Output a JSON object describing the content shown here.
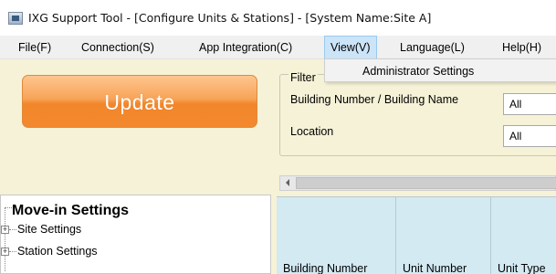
{
  "window": {
    "title": "IXG Support Tool - [Configure Units & Stations] - [System Name:Site A]"
  },
  "menu": {
    "items": [
      {
        "label": "File(F)"
      },
      {
        "label": "Connection(S)"
      },
      {
        "label": "App Integration(C)"
      },
      {
        "label": "View(V)",
        "active": true
      },
      {
        "label": "Language(L)"
      },
      {
        "label": "Help(H)"
      }
    ],
    "view_dropdown": {
      "items": [
        {
          "label": "Administrator Settings"
        }
      ]
    }
  },
  "toolbar": {
    "update_label": "Update"
  },
  "filter": {
    "legend": "Filter",
    "building_label": "Building Number / Building Name",
    "building_value": "All",
    "location_label": "Location",
    "location_value": "All"
  },
  "tree": {
    "root_label": "Move-in Settings",
    "items": [
      {
        "label": "Site Settings"
      },
      {
        "label": "Station Settings"
      }
    ]
  },
  "grid": {
    "columns": [
      "Building Number",
      "Unit Number",
      "Unit Type"
    ]
  },
  "colors": {
    "content_bg": "#f6f2d7",
    "update_button": "#f2862a",
    "grid_header_bg": "#d3eaf3",
    "menu_active_bg": "#cce4f7"
  }
}
